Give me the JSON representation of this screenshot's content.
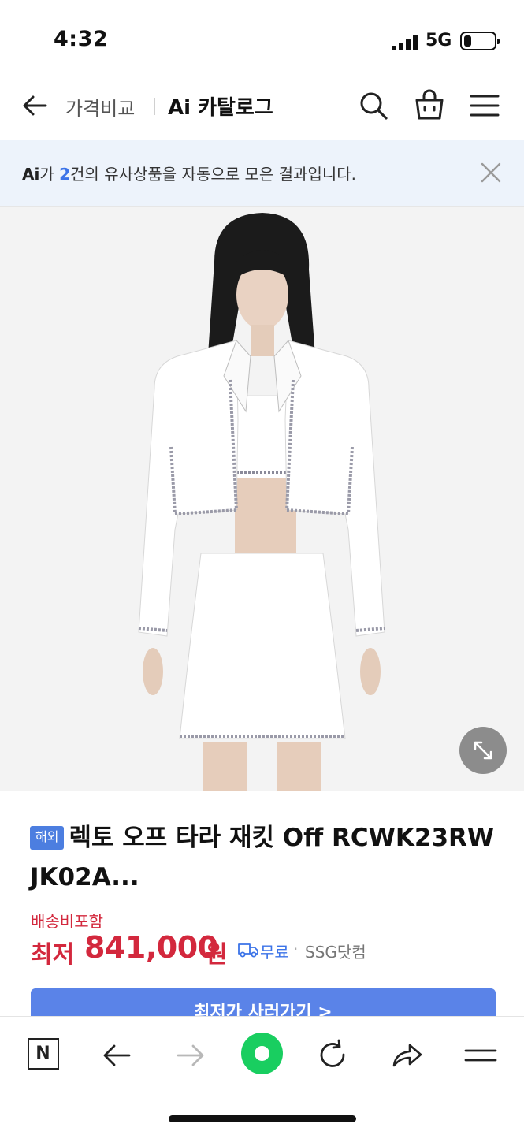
{
  "status_bar": {
    "time": "4:32",
    "network": "5G",
    "battery_level": 0.25
  },
  "header": {
    "back_icon": "arrow-left-icon",
    "subtitle": "가격비교",
    "title": "Ai 카탈로그",
    "search_icon": "search-icon",
    "cart_icon": "shopping-bag-icon",
    "menu_icon": "hamburger-menu-icon"
  },
  "notice": {
    "ai_mark": "Ai",
    "prefix": "가 ",
    "count": "2",
    "suffix": "건의 유사상품을 자동으로 모은 결과입니다.",
    "close_icon": "close-icon"
  },
  "product": {
    "image_alt": "model wearing white cropped tweed jacket and mini skirt",
    "expand_icon": "expand-icon",
    "badge": "해외",
    "title": "렉토 오프 타라 재킷 Off RCWK23RW JK02A...",
    "shipping_note": "배송비포함",
    "price_label": "최저",
    "price": "841,000",
    "price_unit": "원",
    "shipping_icon": "truck-icon",
    "shipping_free": "무료",
    "separator": "·",
    "seller": "SSG닷컴",
    "cta_label": "최저가 사러가기 >"
  },
  "toolbar": {
    "items": [
      {
        "name": "naver-home-icon",
        "label": "N"
      },
      {
        "name": "back-arrow-icon"
      },
      {
        "name": "forward-arrow-icon"
      },
      {
        "name": "green-dot-icon"
      },
      {
        "name": "reload-icon"
      },
      {
        "name": "share-icon"
      },
      {
        "name": "menu-icon"
      }
    ]
  },
  "colors": {
    "accent_blue": "#3b73e8",
    "price_red": "#d3283d",
    "notice_bg": "#edf3fb",
    "badge_blue": "#4c7ee0",
    "cta_blue": "#5a83e8",
    "naver_green": "#19ce60"
  }
}
